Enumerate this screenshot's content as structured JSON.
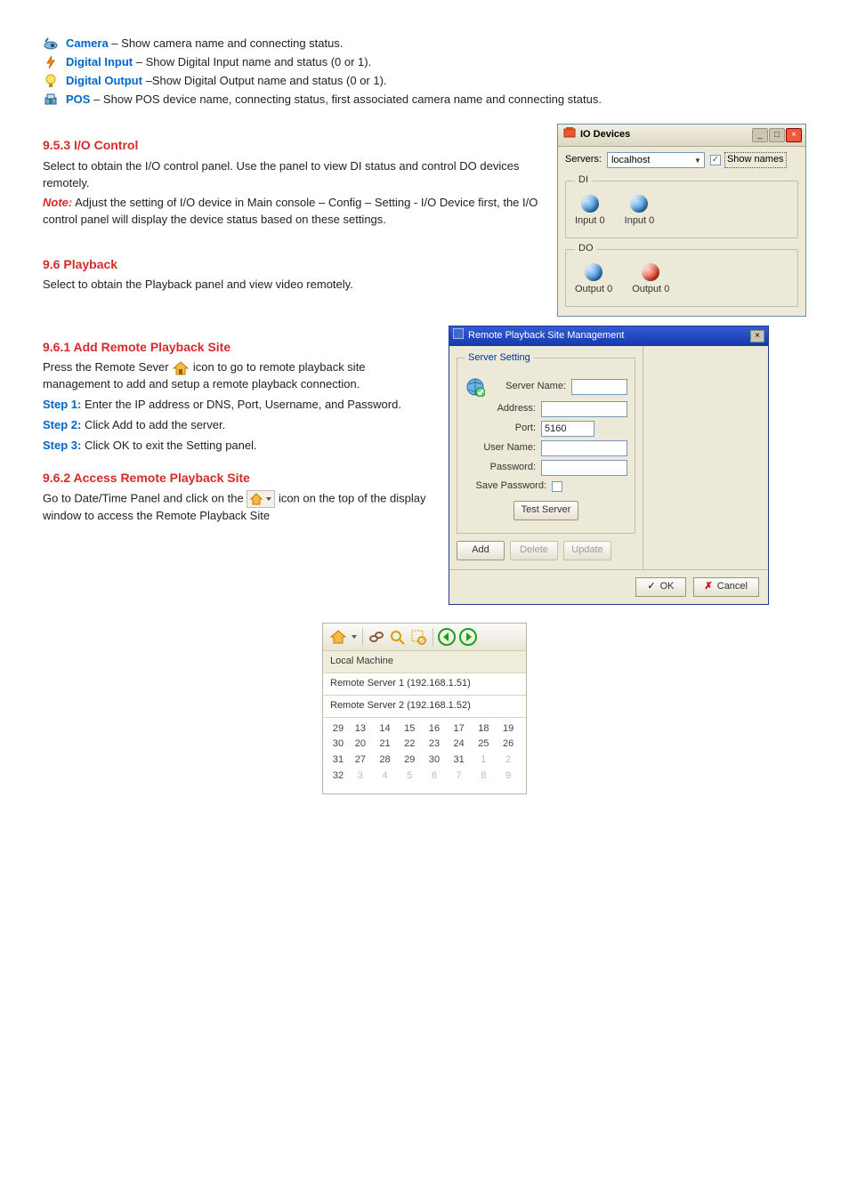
{
  "bullets": {
    "camera": {
      "label": "Camera",
      "text": "– Show camera name and connecting status."
    },
    "di": {
      "label": "Digital Input",
      "text": "– Show Digital Input name and status (0 or 1)."
    },
    "do": {
      "label": "Digital Output",
      "text": "–Show Digital Output name and status (0 or 1)."
    },
    "pos": {
      "label": "POS",
      "text": "– Show POS device name, connecting status, first associated camera name and connecting status."
    }
  },
  "sec953": {
    "heading": "9.5.3 I/O Control",
    "line1": "Select to obtain the I/O control panel.   Use the panel to view DI status and control DO devices remotely.",
    "note_label": "Note:",
    "note_text": " Adjust the setting of I/O device in Main console – Config – Setting - I/O Device first, the I/O control panel will display the device status based on these settings."
  },
  "sec96": {
    "heading": "9.6 Playback",
    "line": "Select to obtain the Playback panel and view video remotely."
  },
  "sec961": {
    "heading": "9.6.1 Add Remote Playback Site",
    "pre": "Press the Remote Sever",
    "post": " icon to go to remote playback site management to add and setup a remote playback connection.",
    "steps": [
      {
        "k": "Step 1:",
        "v": " Enter the IP address or DNS, Port, Username, and Password."
      },
      {
        "k": "Step 2:",
        "v": " Click Add to add the server."
      },
      {
        "k": "Step 3:",
        "v": " Click OK to exit the Setting panel."
      }
    ]
  },
  "sec962": {
    "heading": "9.6.2 Access Remote Playback Site",
    "pre": "Go to Date/Time Panel and click on the ",
    "post": " icon on the top of the display window to access the Remote Playback Site"
  },
  "io_window": {
    "title": "IO Devices",
    "servers_label": "Servers:",
    "server_value": "localhost",
    "shownames_label": "Show names",
    "di_legend": "DI",
    "do_legend": "DO",
    "di_items": [
      "Input 0",
      "Input 0"
    ],
    "do_items": [
      "Output 0",
      "Output 0"
    ]
  },
  "rpm_window": {
    "title": "Remote Playback Site Management",
    "legend": "Server Setting",
    "labels": {
      "server_name": "Server Name:",
      "address": "Address:",
      "port": "Port:",
      "user": "User Name:",
      "pass": "Password:",
      "savepass": "Save Password:"
    },
    "port_value": "5160",
    "buttons": {
      "test": "Test Server",
      "add": "Add",
      "delete": "Delete",
      "update": "Update",
      "ok": "OK",
      "cancel": "Cancel"
    }
  },
  "dtpanel": {
    "rows": [
      "Local Machine",
      "Remote Server 1 (192.168.1.51)",
      "Remote Server 2 (192.168.1.52)"
    ],
    "weeks": [
      "29",
      "30",
      "31",
      "32"
    ],
    "grid": [
      [
        "13",
        "14",
        "15",
        "16",
        "17",
        "18",
        "19"
      ],
      [
        "20",
        "21",
        "22",
        "23",
        "24",
        "25",
        "26"
      ],
      [
        "27",
        "28",
        "29",
        "30",
        "31",
        "1",
        "2"
      ],
      [
        "3",
        "4",
        "5",
        "6",
        "7",
        "8",
        "9"
      ]
    ]
  }
}
